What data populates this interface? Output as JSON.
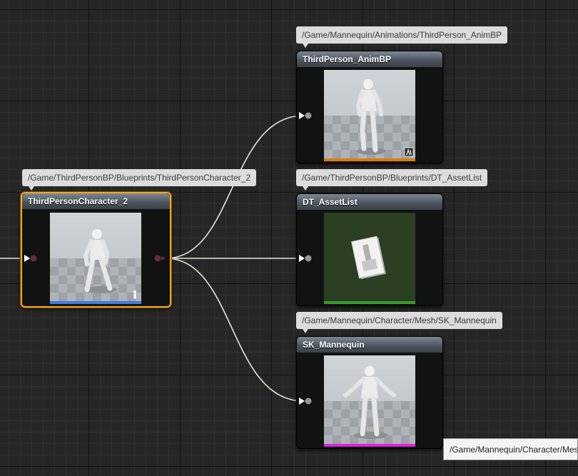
{
  "graph": {
    "background_color": "#262626",
    "selection_color": "#f5a623",
    "wire_color": "#e6e6d8"
  },
  "nodes": {
    "source": {
      "title": "ThirdPersonCharacter_2",
      "path": "/Game/ThirdPersonBP/Blueprints/ThirdPersonCharacter_2",
      "bar_color": "#3d7be0",
      "corner_icon": "character-icon"
    },
    "anim_bp": {
      "title": "ThirdPerson_AnimBP",
      "path": "/Game/Mannequin/Animations/ThirdPerson_AnimBP",
      "bar_color": "#e07a10",
      "corner_icon": "anim-blueprint-icon"
    },
    "asset_list": {
      "title": "DT_AssetList",
      "path": "/Game/ThirdPersonBP/Blueprints/DT_AssetList",
      "bar_color": "#3a9a2a",
      "corner_icon": "data-table-icon"
    },
    "mannequin": {
      "title": "SK_Mannequin",
      "path": "/Game/Mannequin/Character/Mesh/SK_Mannequin",
      "bar_color": "#e020e0",
      "corner_icon": "skeletal-mesh-icon"
    }
  },
  "tooltip": {
    "text": "/Game/Mannequin/Character/Mesh/SK_Mannequin"
  }
}
